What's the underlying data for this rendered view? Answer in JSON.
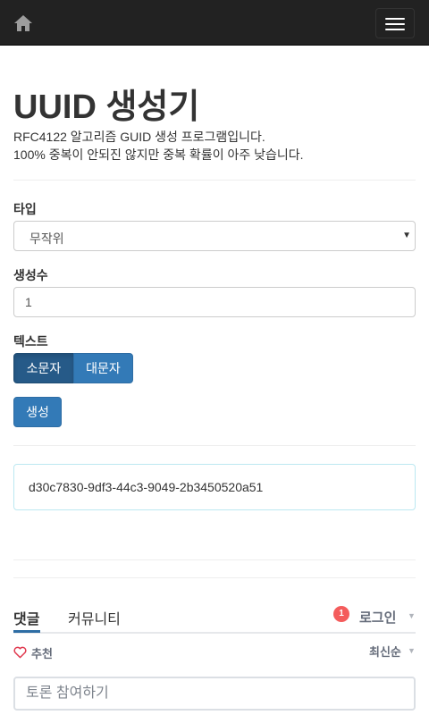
{
  "navbar": {
    "home_icon": "home-icon",
    "menu_icon": "hamburger-icon",
    "background": "#222222"
  },
  "page": {
    "title": "UUID 생성기",
    "description_line1": "RFC4122 알고리즘 GUID 생성 프로그램입니다.",
    "description_line2": "100% 중복이 안되진 않지만 중복 확률이 아주 낮습니다."
  },
  "form": {
    "type_label": "타입",
    "type_selected": "무작위",
    "count_label": "생성수",
    "count_value": "1",
    "text_label": "텍스트",
    "lowercase_label": "소문자",
    "uppercase_label": "대문자",
    "generate_label": "생성"
  },
  "result": {
    "uuid": "d30c7830-9df3-44c3-9049-2b3450520a51"
  },
  "comments": {
    "tab_comments": "댓글",
    "tab_community": "커뮤니티",
    "notification_count": "1",
    "login_label": "로그인",
    "recommend_label": "추천",
    "sort_label": "최신순",
    "input_placeholder": "토론 참여하기"
  },
  "colors": {
    "primary": "#337ab7",
    "primary_active": "#265a88",
    "badge": "#f45c5c",
    "heart": "#e0374d"
  }
}
